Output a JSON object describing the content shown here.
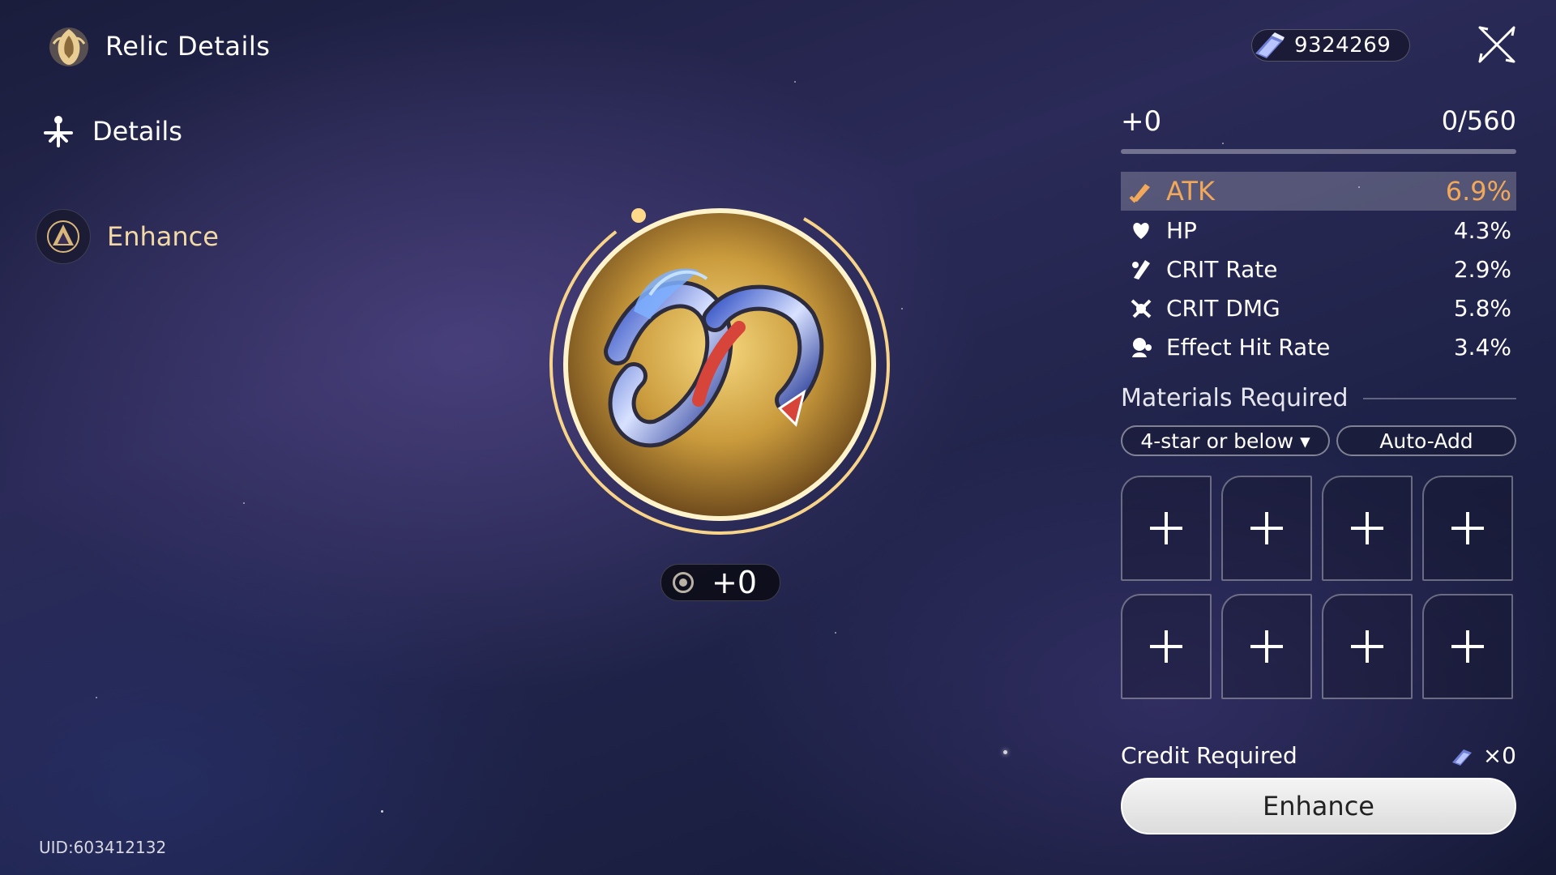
{
  "header": {
    "title": "Relic Details"
  },
  "nav": {
    "details": "Details",
    "enhance": "Enhance"
  },
  "uid": "UID:603412132",
  "currency": {
    "value": "9324269"
  },
  "relic": {
    "level_badge": "+0"
  },
  "panel": {
    "level": "+0",
    "exp": "0/560",
    "exp_fraction": 0,
    "main_stat": {
      "name": "ATK",
      "value": "6.9%",
      "icon": "atk-icon"
    },
    "sub_stats": [
      {
        "name": "HP",
        "value": "4.3%",
        "icon": "hp-icon"
      },
      {
        "name": "CRIT Rate",
        "value": "2.9%",
        "icon": "crit-rate-icon"
      },
      {
        "name": "CRIT DMG",
        "value": "5.8%",
        "icon": "crit-dmg-icon"
      },
      {
        "name": "Effect Hit Rate",
        "value": "3.4%",
        "icon": "effect-hit-rate-icon"
      }
    ],
    "materials_title": "Materials Required",
    "filter_label": "4-star or below ▾",
    "auto_add_label": "Auto-Add",
    "credit_label": "Credit Required",
    "credit_value": "×0",
    "enhance_button": "Enhance"
  },
  "colors": {
    "accent": "#f1a85a",
    "highlight": "#f2d9a6"
  }
}
